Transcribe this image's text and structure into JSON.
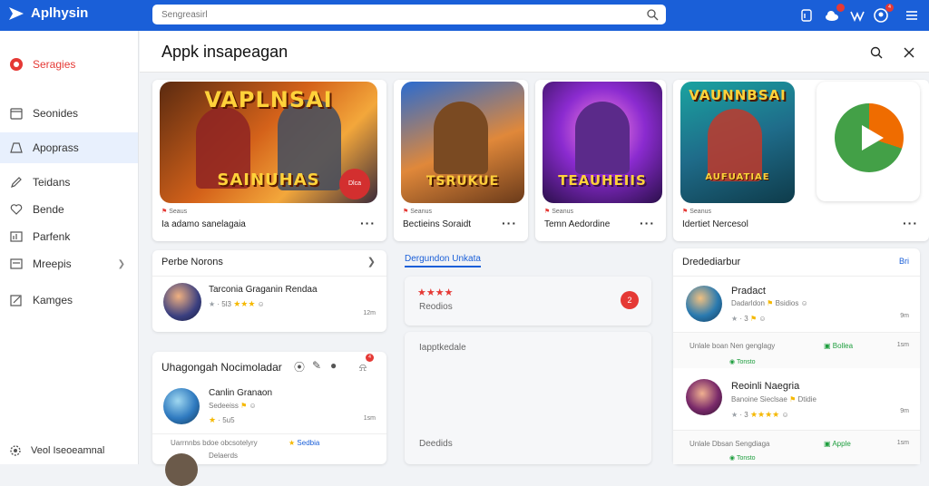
{
  "app": {
    "name": "Aplhysin"
  },
  "search": {
    "placeholder": "Sengreasirl"
  },
  "topbar": {
    "badges": [
      "",
      "4"
    ]
  },
  "sidebar": {
    "items": [
      {
        "label": "Seragies"
      },
      {
        "label": "Seonides"
      },
      {
        "label": "Apoprass"
      },
      {
        "label": "Teidans"
      },
      {
        "label": "Bende"
      },
      {
        "label": "Parfenk"
      },
      {
        "label": "Mreepis"
      },
      {
        "label": "Kamges"
      }
    ],
    "footer": "Veol Iseoeamnal"
  },
  "header": {
    "title": "Appk insapeagan"
  },
  "games": [
    {
      "art": "VAPLNSAI",
      "art2": "SAINUHAS",
      "tag": "Seaus",
      "title": "Ia adamo sanelagaia",
      "badge": "Dlca"
    },
    {
      "art": "",
      "art2": "TSRUKUE",
      "tag": "Seanus",
      "title": "Bectieins Soraidt",
      "badge": ""
    },
    {
      "art": "",
      "art2": "TEAUHEIIS",
      "tag": "Seanus",
      "title": "Temn Aedordine",
      "badge": ""
    },
    {
      "art": "VAUNNBSAI",
      "art2": "AUFUATIAE",
      "tag": "Seanus",
      "title": "Idertiet Nercesol",
      "badge": ""
    }
  ],
  "left_panel": {
    "title": "Perbe Norons",
    "item": {
      "name": "Tarconia Graganin Rendaa",
      "stats": "5l3",
      "time": "12m"
    }
  },
  "upcoming": {
    "title": "Uhagongah Nocimoladar",
    "badge": "4",
    "item": {
      "name": "Canlin Granaon",
      "sub": "Sedeeiss",
      "stats": "5u5",
      "time": "1sm"
    },
    "footer_text": "Uarrnnbs bdoe obcsotelyry",
    "footer_link": "Sedbia",
    "footer_sub": "Delaerds"
  },
  "middle": {
    "tab": "Dergundon Unkata",
    "card1": {
      "label": "Reodios",
      "count": "2"
    },
    "card2_label": "Iapptkedale",
    "card3_label": "Deedids"
  },
  "right_panel": {
    "title": "Dredediarbur",
    "link": "Bri",
    "items": [
      {
        "name": "Pradact",
        "sub": "Dadarldon",
        "tag": "Bsidios",
        "stats": "3",
        "time": "9m"
      },
      {
        "name": "Reoinli Naegria",
        "sub": "Banoine Sieclsae",
        "tag": "Dtidie",
        "stats": "3",
        "time": "9m"
      }
    ],
    "update1": {
      "text": "Unlale boan Nen genglagy",
      "link": "Bollea",
      "time": "1sm",
      "sub": "Tonsto"
    },
    "update2": {
      "text": "Unlale Dbsan Sengdiaga",
      "link": "Apple",
      "time": "1sm",
      "sub": "Tonsto"
    }
  },
  "colors": {
    "accent": "#1a5fd8",
    "danger": "#e53935",
    "star": "#f5b800",
    "play_green": "#43a047",
    "play_orange": "#ef6c00"
  }
}
